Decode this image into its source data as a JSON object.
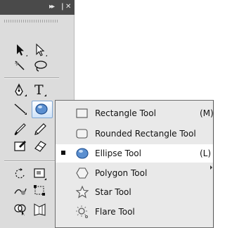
{
  "toolbox": {
    "collapse_icon": "double-chevron-right-icon",
    "close_icon": "close-x-icon"
  },
  "tools": [
    {
      "name": "selection-tool-icon"
    },
    {
      "name": "direct-selection-tool-icon"
    },
    {
      "name": "magic-wand-tool-icon"
    },
    {
      "name": "lasso-tool-icon"
    },
    {
      "name": "pen-tool-icon"
    },
    {
      "name": "type-tool-icon",
      "glyph": "T"
    },
    {
      "name": "line-segment-tool-icon"
    },
    {
      "name": "ellipse-tool-icon"
    },
    {
      "name": "paintbrush-tool-icon"
    },
    {
      "name": "pencil-tool-icon"
    },
    {
      "name": "blob-brush-tool-icon"
    },
    {
      "name": "eraser-tool-icon"
    },
    {
      "name": "rotate-tool-icon"
    },
    {
      "name": "scale-tool-icon"
    },
    {
      "name": "warp-tool-icon"
    },
    {
      "name": "free-transform-tool-icon"
    },
    {
      "name": "shape-builder-tool-icon"
    },
    {
      "name": "perspective-grid-tool-icon"
    }
  ],
  "flyout": {
    "items": [
      {
        "label": "Rectangle Tool",
        "shortcut": "(M)",
        "icon": "rectangle-icon",
        "selected": false
      },
      {
        "label": "Rounded Rectangle Tool",
        "shortcut": "",
        "icon": "rounded-rectangle-icon",
        "selected": false
      },
      {
        "label": "Ellipse Tool",
        "shortcut": "(L)",
        "icon": "ellipse-icon",
        "selected": true
      },
      {
        "label": "Polygon Tool",
        "shortcut": "",
        "icon": "polygon-icon",
        "selected": false
      },
      {
        "label": "Star Tool",
        "shortcut": "",
        "icon": "star-icon",
        "selected": false
      },
      {
        "label": "Flare Tool",
        "shortcut": "",
        "icon": "flare-icon",
        "selected": false
      }
    ]
  },
  "colors": {
    "toolbox_bg": "#dcdcdc",
    "titlebar_bg": "#4a4a4a",
    "flyout_bg": "#e9e9e9",
    "selected_row_bg": "#ffffff",
    "accent_blue": "#5b8fd0"
  }
}
